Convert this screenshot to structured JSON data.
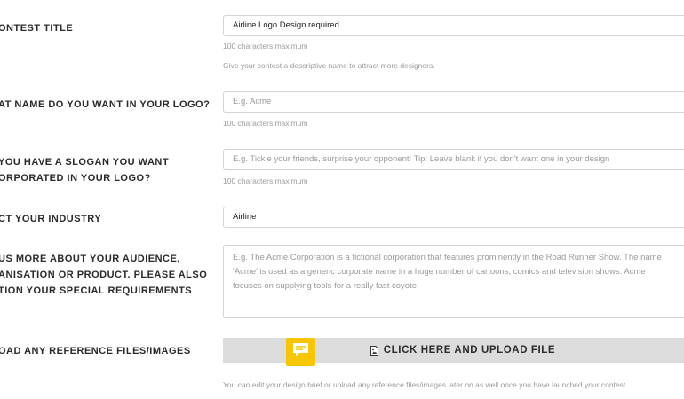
{
  "form": {
    "contest_title": {
      "label": "ONTEST TITLE",
      "value": "Airline Logo Design required",
      "help1": "100 characters maximum",
      "help2": "Give your contest a descriptive name to attract more designers."
    },
    "logo_name": {
      "label": "AT NAME DO YOU WANT IN YOUR LOGO?",
      "placeholder": "E.g. Acme",
      "help": "100 characters maximum"
    },
    "slogan": {
      "label_line1": "YOU HAVE A SLOGAN YOU WANT",
      "label_line2": "ORPORATED IN YOUR LOGO?",
      "placeholder": "E.g. Tickle your friends, surprise your opponent!  Tip: Leave blank if you don't want one in your design",
      "help": "100 characters maximum"
    },
    "industry": {
      "label": "CT YOUR INDUSTRY",
      "value": "Airline"
    },
    "audience": {
      "label_line1": "US MORE ABOUT YOUR AUDIENCE,",
      "label_line2": "ANISATION OR PRODUCT. PLEASE ALSO",
      "label_line3": "TION YOUR SPECIAL REQUIREMENTS",
      "placeholder_line1": "E.g. The Acme Corporation is a fictional corporation that features prominently in the Road Runner Show. The name",
      "placeholder_line2": "'Acme' is used as a generic corporate name in a huge number of cartoons, comics and television shows. Acme",
      "placeholder_line3": "focuses on supplying tools for a really fast coyote."
    },
    "upload": {
      "label": "OAD ANY REFERENCE FILES/IMAGES",
      "button_label": "CLICK HERE AND UPLOAD FILE",
      "note": "You can edit your design brief or upload any reference files/images later on as well once you have launched your contest."
    }
  },
  "icons": {
    "upload": "file-image-icon",
    "chat": "chat-bubble-icon"
  },
  "colors": {
    "chat_widget": "#f7c600",
    "upload_bar": "#dcdcdc"
  }
}
